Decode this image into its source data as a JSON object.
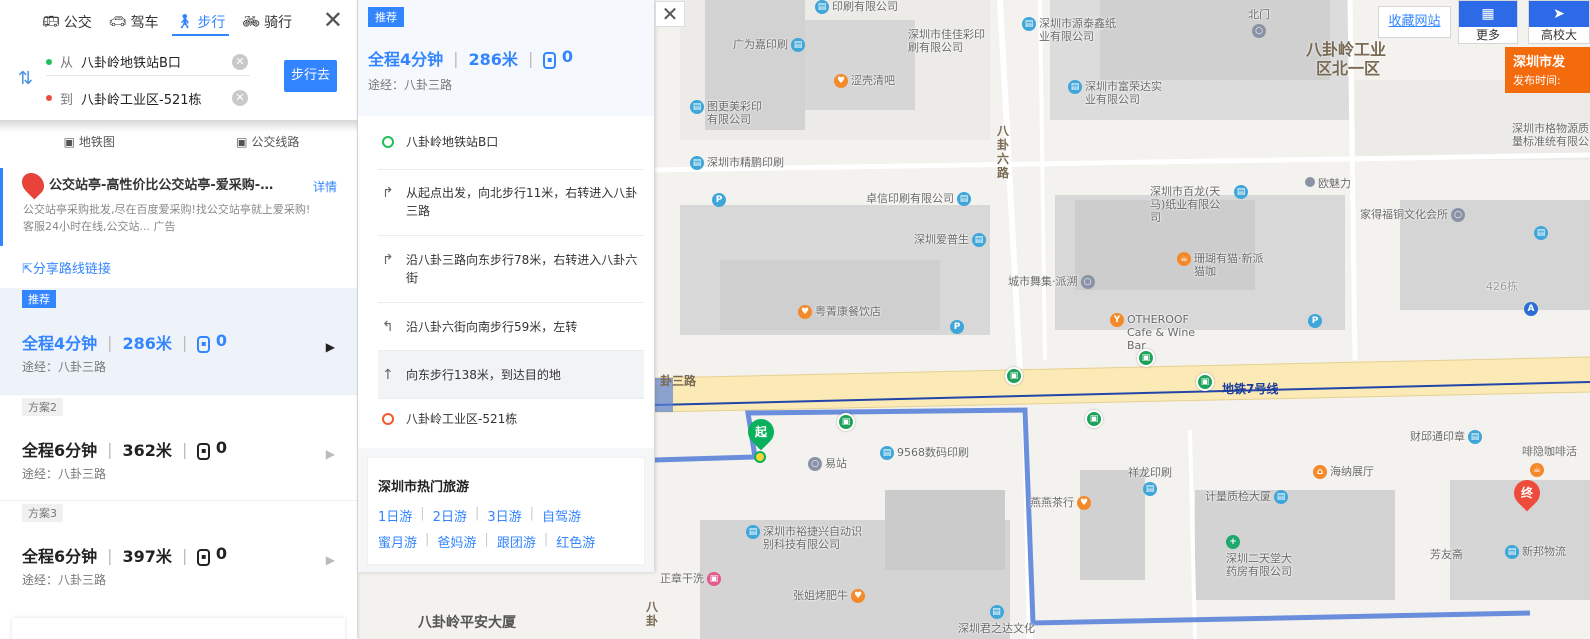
{
  "transport_modes": [
    {
      "label": "公交",
      "icon": "bus-icon"
    },
    {
      "label": "驾车",
      "icon": "car-icon"
    },
    {
      "label": "步行",
      "icon": "walk-icon",
      "active": true
    },
    {
      "label": "骑行",
      "icon": "bike-icon"
    }
  ],
  "route_inputs": {
    "from_prefix": "从",
    "from_value": "八卦岭地铁站B口",
    "to_prefix": "到",
    "to_value": "八卦岭工业区-521栋",
    "go_button": "步行去"
  },
  "sub_tabs": [
    {
      "label": "地铁图",
      "icon": "subway-icon"
    },
    {
      "label": "公交线路",
      "icon": "bus-icon"
    }
  ],
  "ad": {
    "title": "公交站亭-高性价比公交站亭-爱采购-品...",
    "detail_link": "详情",
    "body_line1": "公交站亭采购批发,尽在百度爱采购!找公交站亭就上爱采购!",
    "body_line2": "客服24小时在线,公交站... 广告"
  },
  "share_link": "分享路线链接",
  "plans": [
    {
      "tag": "推荐",
      "duration": "全程4分钟",
      "distance": "286米",
      "transfers": "0",
      "via": "途经：八卦三路"
    },
    {
      "tag": "方案2",
      "duration": "全程6分钟",
      "distance": "362米",
      "transfers": "0",
      "via": "途经：八卦三路"
    },
    {
      "tag": "方案3",
      "duration": "全程6分钟",
      "distance": "397米",
      "transfers": "0",
      "via": "途经：八卦三路"
    }
  ],
  "step_panel": {
    "tag": "推荐",
    "duration": "全程4分钟",
    "distance": "286米",
    "transfers": "0",
    "via": "途经：八卦三路",
    "steps": [
      {
        "type": "start",
        "text": "八卦岭地铁站B口"
      },
      {
        "type": "turn-right",
        "text": "从起点出发，向北步行11米，右转进入八卦三路"
      },
      {
        "type": "turn-right",
        "text": "沿八卦三路向东步行78米，右转进入八卦六街"
      },
      {
        "type": "turn-left",
        "text": "沿八卦六街向南步行59米，左转"
      },
      {
        "type": "straight",
        "text": "向东步行138米，到达目的地"
      },
      {
        "type": "end",
        "text": "八卦岭工业区-521栋"
      }
    ],
    "tourism": {
      "title": "深圳市热门旅游",
      "row1": [
        "1日游",
        "2日游",
        "3日游",
        "自驾游"
      ],
      "row2": [
        "蜜月游",
        "爸妈游",
        "跟团游",
        "红色游"
      ]
    }
  },
  "top_controls": {
    "favorite_link": "收藏网站",
    "more_label": "更多",
    "edu_label": "高校大"
  },
  "warning_banner": {
    "line1": "深圳市发",
    "line2": "发布时间:"
  },
  "map": {
    "area_label_line1": "八卦岭工业",
    "area_label_line2": "区北一区",
    "road_vertical_1": "八卦六路",
    "road_vertical_2": "八卦",
    "road_main": "卦三路",
    "metro_line": "地铁7号线",
    "start_pin": "起",
    "end_pin": "终",
    "bottom_label": "八卦岭平安大厦",
    "pois": [
      "印刷有限公司",
      "广为嘉印刷",
      "深圳市佳佳彩印刷有限公司",
      "深圳市源泰鑫纸业有限公司",
      "北门",
      "深圳市富荣达实业有限公司",
      "涩壳清吧",
      "图更美彩印有限公司",
      "深圳市精鹏印刷",
      "深圳市格物源质量标准统有限公",
      "卓信印刷有限公司",
      "深圳市百龙(天马)纸业有限公司",
      "欧魅力",
      "家得福铜文化会所",
      "深圳爱普生",
      "珊瑚有猫·新派猫咖",
      "城市舞集·派溯",
      "426栋",
      "粤菁康餐饮店",
      "OTHEROOF Cafe & Wine Bar",
      "易站",
      "9568数码印刷",
      "财邱通印章",
      "啡隐咖啡活",
      "祥龙印刷",
      "海纳展厅",
      "燕燕茶行",
      "计量质检大厦",
      "深圳市裕捷兴自动识别科技有限公司",
      "深圳二天堂大药房有限公司",
      "芳友斋",
      "新邦物流",
      "正章干洗",
      "张姐烤肥牛",
      "深圳君之达文化"
    ]
  }
}
